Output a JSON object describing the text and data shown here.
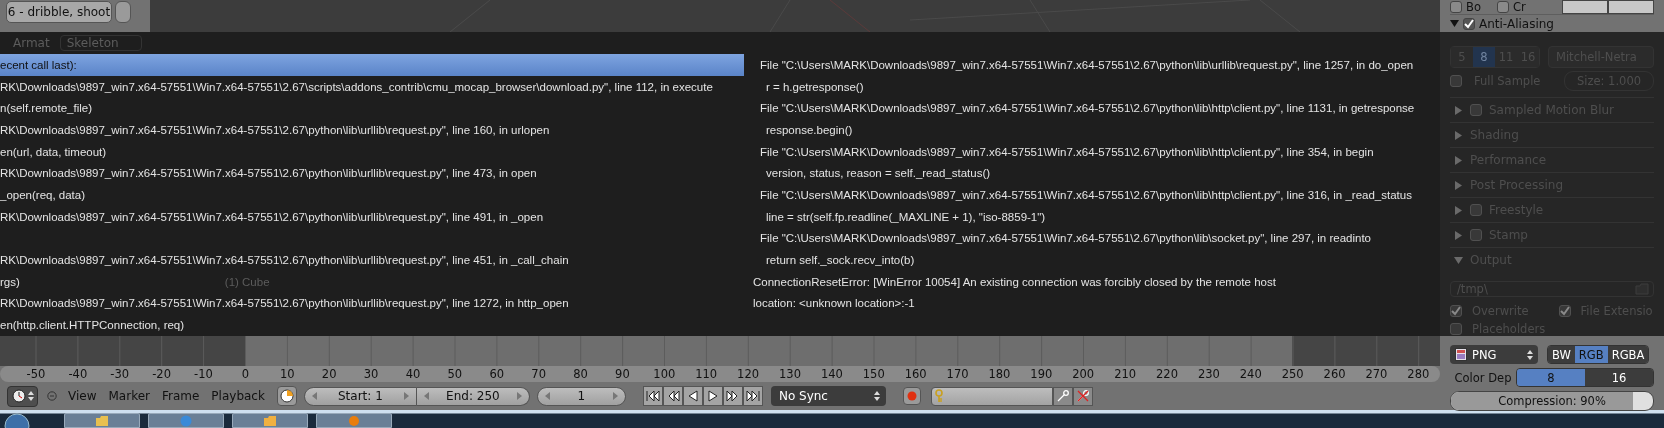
{
  "left_panel": {
    "list_item": "6 - dribble, shoot"
  },
  "error_popup": {
    "background_labels": [
      "Armat",
      "Skeleton"
    ],
    "rows": [
      {
        "selected": true,
        "left": "ecent call last):",
        "right": {
          "kind": "file",
          "text": "File \"C:\\Users\\MARK\\Downloads\\9897_win7.x64-57551\\Win7.x64-57551\\2.67\\python\\lib\\urllib\\request.py\", line 1257, in do_open"
        }
      },
      {
        "selected": false,
        "left": "RK\\Downloads\\9897_win7.x64-57551\\Win7.x64-57551\\2.67\\scripts\\addons_contrib\\cmu_mocap_browser\\download.py\", line 112, in execute",
        "right": {
          "kind": "code",
          "text": "r = h.getresponse()"
        }
      },
      {
        "selected": false,
        "left": "n(self.remote_file)",
        "right": {
          "kind": "file",
          "text": "File \"C:\\Users\\MARK\\Downloads\\9897_win7.x64-57551\\Win7.x64-57551\\2.67\\python\\lib\\http\\client.py\", line 1131, in getresponse"
        }
      },
      {
        "selected": false,
        "left": "RK\\Downloads\\9897_win7.x64-57551\\Win7.x64-57551\\2.67\\python\\lib\\urllib\\request.py\", line 160, in urlopen",
        "right": {
          "kind": "code",
          "text": "response.begin()"
        }
      },
      {
        "selected": false,
        "left": "en(url, data, timeout)",
        "right": {
          "kind": "file",
          "text": "File \"C:\\Users\\MARK\\Downloads\\9897_win7.x64-57551\\Win7.x64-57551\\2.67\\python\\lib\\http\\client.py\", line 354, in begin"
        }
      },
      {
        "selected": false,
        "left": "RK\\Downloads\\9897_win7.x64-57551\\Win7.x64-57551\\2.67\\python\\lib\\urllib\\request.py\", line 473, in open",
        "right": {
          "kind": "code",
          "text": "version, status, reason = self._read_status()"
        }
      },
      {
        "selected": false,
        "left": "_open(req, data)",
        "right": {
          "kind": "file",
          "text": "File \"C:\\Users\\MARK\\Downloads\\9897_win7.x64-57551\\Win7.x64-57551\\2.67\\python\\lib\\http\\client.py\", line 316, in _read_status"
        }
      },
      {
        "selected": false,
        "left": "RK\\Downloads\\9897_win7.x64-57551\\Win7.x64-57551\\2.67\\python\\lib\\urllib\\request.py\", line 491, in _open",
        "right": {
          "kind": "code",
          "text": "line = str(self.fp.readline(_MAXLINE + 1), \"iso-8859-1\")"
        }
      },
      {
        "selected": false,
        "right": {
          "kind": "file",
          "text": "File \"C:\\Users\\MARK\\Downloads\\9897_win7.x64-57551\\Win7.x64-57551\\2.67\\python\\lib\\socket.py\", line 297, in readinto"
        }
      },
      {
        "selected": false,
        "left": "RK\\Downloads\\9897_win7.x64-57551\\Win7.x64-57551\\2.67\\python\\lib\\urllib\\request.py\", line 451, in _call_chain",
        "right": {
          "kind": "code",
          "text": "return self._sock.recv_into(b)"
        }
      },
      {
        "selected": false,
        "left": "rgs)",
        "background_label": "(1) Cube",
        "right": {
          "kind": "message",
          "text": "ConnectionResetError: [WinError 10054] An existing connection was forcibly closed by the remote host"
        }
      },
      {
        "selected": false,
        "left": "RK\\Downloads\\9897_win7.x64-57551\\Win7.x64-57551\\2.67\\python\\lib\\urllib\\request.py\", line 1272, in http_open",
        "right": {
          "kind": "message",
          "text": "location: <unknown location>:-1"
        }
      },
      {
        "selected": false,
        "left": "en(http.client.HTTPConnection, req)"
      }
    ]
  },
  "timeline": {
    "ruler_labels": [
      "-50",
      "-40",
      "-30",
      "-20",
      "-10",
      "0",
      "10",
      "20",
      "30",
      "40",
      "50",
      "60",
      "70",
      "80",
      "90",
      "100",
      "110",
      "120",
      "130",
      "140",
      "150",
      "160",
      "170",
      "180",
      "190",
      "200",
      "210",
      "220",
      "230",
      "240",
      "250",
      "260",
      "270",
      "280"
    ],
    "menu": [
      "View",
      "Marker",
      "Frame",
      "Playback"
    ],
    "start": "Start: 1",
    "end": "End: 250",
    "current_frame": "1",
    "sync": "No Sync"
  },
  "properties_panel": {
    "top_checkboxes": [
      {
        "label": "Bo",
        "checked": false
      },
      {
        "label": "Cr",
        "checked": false
      }
    ],
    "anti_aliasing": {
      "label": "Anti-Aliasing",
      "expanded": true,
      "checked": true
    },
    "samples": [
      {
        "label": "5",
        "selected": false
      },
      {
        "label": "8",
        "selected": true
      },
      {
        "label": "11",
        "selected": false
      },
      {
        "label": "16",
        "selected": false
      }
    ],
    "filter": "Mitchell-Netra",
    "full_sample": {
      "label": "Full Sample",
      "checked": false
    },
    "size": "Size: 1.000",
    "sections": [
      {
        "label": "Sampled Motion Blur",
        "kind": "checkbox",
        "checked": false,
        "expanded": false
      },
      {
        "label": "Shading",
        "kind": "plain",
        "expanded": false
      },
      {
        "label": "Performance",
        "kind": "plain",
        "expanded": false
      },
      {
        "label": "Post Processing",
        "kind": "plain",
        "expanded": false
      },
      {
        "label": "Freestyle",
        "kind": "checkbox",
        "checked": false,
        "expanded": false
      },
      {
        "label": "Stamp",
        "kind": "checkbox",
        "checked": false,
        "expanded": false
      },
      {
        "label": "Output",
        "kind": "plain",
        "expanded": true
      }
    ],
    "output_path": "/tmp\\",
    "output_options": [
      {
        "label": "Overwrite",
        "checked": true
      },
      {
        "label": "File Extensio",
        "checked": true
      }
    ],
    "placeholders": {
      "label": "Placeholders",
      "checked": false
    },
    "file_format": "PNG",
    "color_modes": [
      {
        "label": "BW",
        "selected": false
      },
      {
        "label": "RGB",
        "selected": true
      },
      {
        "label": "RGBA",
        "selected": false
      }
    ],
    "color_depth": {
      "label": "Color Dep",
      "options": [
        {
          "label": "8",
          "selected": true
        },
        {
          "label": "16",
          "selected": false
        }
      ]
    },
    "compression": {
      "label": "Compression: 90%",
      "level": 0.9
    }
  }
}
